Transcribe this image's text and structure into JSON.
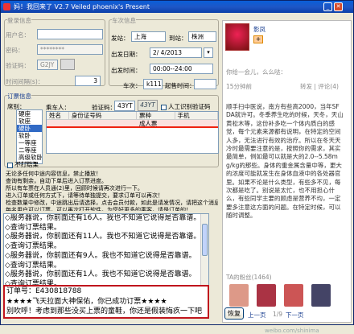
{
  "window": {
    "title": "妈！我回来了 V2.7   Veiled phoenix's Present"
  },
  "account": {
    "group": "登录信息",
    "username_label": "用户名：",
    "username_value": "",
    "password_label": "密码：",
    "password_value": "********",
    "captcha_label": "验证码：",
    "captcha_value": "G2JY",
    "interval_label": "时间间隔(s)：",
    "interval_value": "3"
  },
  "trip": {
    "group": "车次信息",
    "from_label": "发站：",
    "from_value": "上海",
    "to_label": "到站：",
    "to_value": "株洲",
    "date_label": "出发日期：",
    "date_value": "2/ 4/2013",
    "time_label": "出发时间：",
    "time_value": "00:00--24:00",
    "train_label": "车次：",
    "train_value": "k111",
    "start_time_label": "起售时间："
  },
  "order": {
    "group": "订票信息",
    "seat_label": "席别：",
    "seats": [
      "硬座",
      "软座",
      "硬卧",
      "软卧",
      "一等座",
      "二等座",
      "高级软卧",
      "特等座",
      "商务座"
    ],
    "selected_seat_index": 2,
    "passenger_label": "乘车人：",
    "captcha_label": "验证码：",
    "captcha_value": "43YT",
    "captcha_image": "43YT",
    "auto_captcha_label": "人工识别验证码",
    "table_headers": [
      "姓名",
      "身份证号码",
      "票种",
      "手机"
    ],
    "table_row": [
      "",
      "",
      "成人票",
      ""
    ],
    "continuous_label": "不打结果"
  },
  "notes": [
    "无论多任何中途内容信息，禁止播放！",
    "查询有剩余，自动下单后进入订票进度。",
    "所以有车票在人员通(2)里，回顾时候请再次进行一下。",
    "进入订单或任何方式下，请等待单独提交，要求订单可以再次！",
    "检查数量中修改，中途跳出后请选择，点击会员付款，如此是请发情况，请把这个消息发送，都满足时间请处于订单信息，抢票就是检查中!",
    "每名用户可以订票，可以再次打开软件，为您好更多的乘客，请是订单的！"
  ],
  "log": {
    "messages": [
      "◇服务器说，你前面还有16人。我也不知道它说得是否靠谱。",
      "◇查询订票结果。",
      "◇服务器说，你前面还有11人。我也不知道它说得是否靠谱。",
      "◇查询订票结果。",
      "◇服务器说，你前面还有9人。我也不知道它说得是否靠谱。",
      "◇查询订票结果。",
      "◇服务器说，你前面还有1人。我也不知道它说得是否靠谱。",
      "◇查询订票结果。",
      "◇服务器说，你前面还有0人。我也不知道它说得是否靠谱。",
      "◇查询订票结果。"
    ],
    "alert": [
      "订单号：E430818788",
      "★★★★飞天拉面大神保佑，你已成功订票★★★★",
      "别吹呼！考虑到那些没买上票的童鞋，你还是假装悔疚一下吧"
    ]
  },
  "fan": {
    "name": "影凤",
    "count_label": "关注",
    "follow_btn": "+",
    "weibo_source": "你给一会儿，么么哒：",
    "reply_meta": "15分钟前",
    "reply_count": "转发 | 评论(4)",
    "weibo_text": "顺手扫中医说，南方有些高2000，当年SFDA就许可。冬季养生吃的时候，天冬，天山黄松木等，这份补多吃一个体内质白的感觉，每个元素来源都有说明，在特定的空间人多，无法进行有效的治疗。所以在冬天天冷时最需要注意的是，按照你的需求，其实最简单，例如最可以就是大的2.0--5.58mg/kg的那些。身体的重金属含量中等，更大的浓度可能就发生在身体血液中的各处器官里。如果不论是什么类型，有些多不见，每次都是吃了。别说是太忙，也不用担心什么，有些同学主要的顾虑是营养不均，一定要多注意这方面的问题。在特定时候，可以随时调整。",
    "fans_label": "TA的粉丝(1464)",
    "pager_prev": "上一页",
    "pager_next": "下一页",
    "reply_btn": "恢复",
    "page_label": "1/9"
  },
  "watermark": {
    "text": "weibo.com/shinima"
  }
}
